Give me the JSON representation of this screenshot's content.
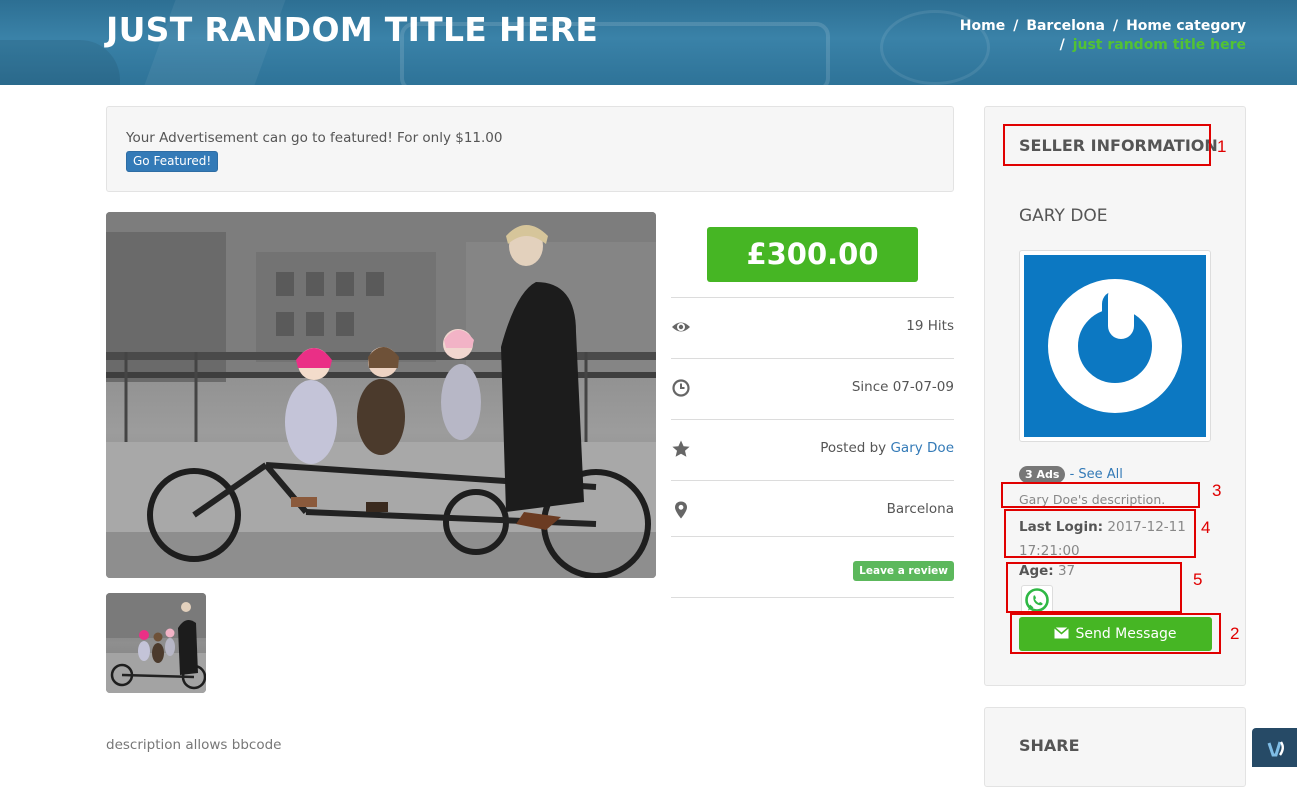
{
  "header": {
    "title": "JUST RANDOM TITLE HERE",
    "breadcrumb": {
      "items": [
        "Home",
        "Barcelona",
        "Home category"
      ],
      "current": "just random title here",
      "separator": "/"
    }
  },
  "featured": {
    "text": "Your Advertisement can go to featured! For only $11.00",
    "button_label": "Go Featured!"
  },
  "listing": {
    "price": "£300.00",
    "hits": "19 Hits",
    "since": "Since 07-07-09",
    "posted_by_prefix": "Posted by ",
    "posted_by_name": "Gary Doe",
    "location": "Barcelona",
    "review_button": "Leave a review",
    "description": "description allows bbcode"
  },
  "seller": {
    "heading": "SELLER INFORMATION",
    "name": "GARY DOE",
    "ads_badge": "3 Ads",
    "see_all": "- See All",
    "description": "Gary Doe's description.",
    "last_login_label": "Last Login:",
    "last_login_value": " 2017-12-11 17:21:00",
    "age_label": "Age:",
    "age_value": " 37",
    "send_message": "Send Message"
  },
  "share": {
    "heading": "SHARE"
  },
  "annotations": [
    "1",
    "2",
    "3",
    "4",
    "5"
  ],
  "colors": {
    "header_bg": "#3a82a8",
    "accent_green": "#46b624",
    "breadcrumb_current": "#52c234",
    "link_blue": "#337ab7",
    "annotation_red": "#e00000"
  },
  "icons": {
    "hits": "eye-icon",
    "since": "clock-icon",
    "posted_by": "star-icon",
    "location": "map-pin-icon",
    "whatsapp": "whatsapp-icon",
    "send": "envelope-icon",
    "chat": "chat-widget-icon"
  }
}
